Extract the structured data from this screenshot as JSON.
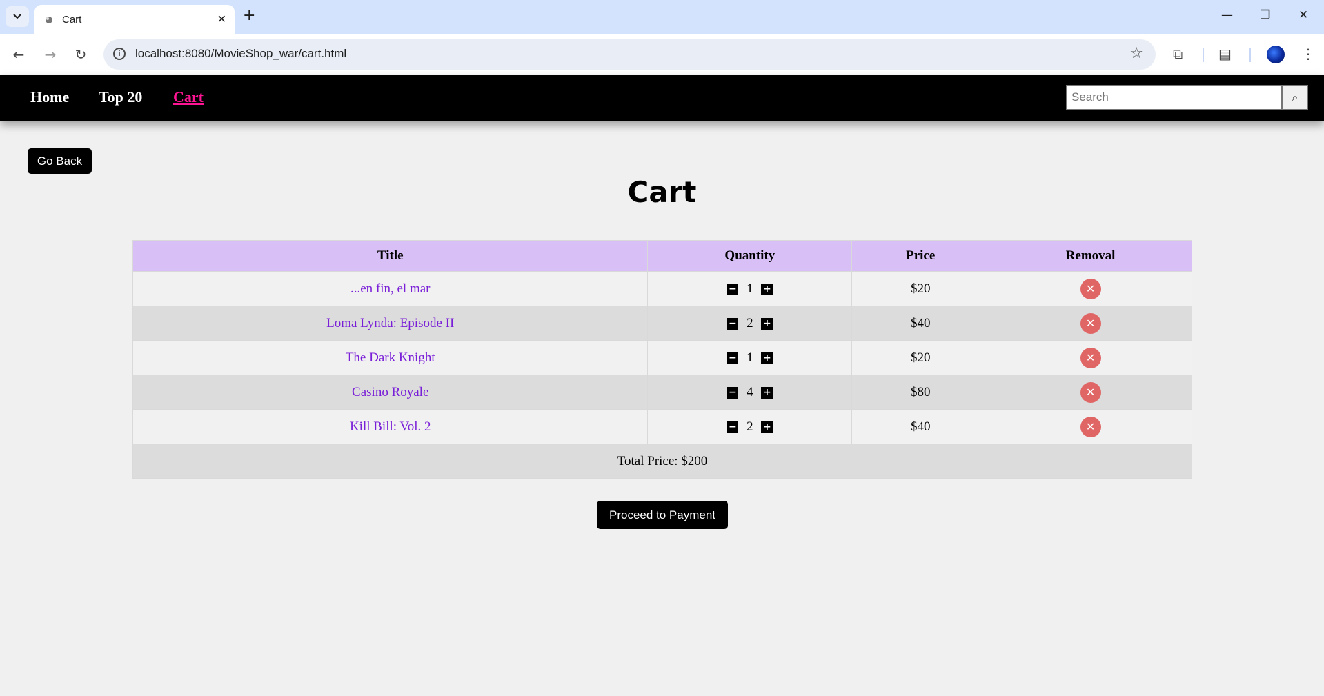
{
  "browser": {
    "tab_title": "Cart",
    "url": "localhost:8080/MovieShop_war/cart.html"
  },
  "nav": {
    "links": [
      {
        "label": "Home",
        "active": false
      },
      {
        "label": "Top 20",
        "active": false
      },
      {
        "label": "Cart",
        "active": true
      }
    ],
    "search_placeholder": "Search"
  },
  "page": {
    "go_back_label": "Go Back",
    "title": "Cart",
    "proceed_label": "Proceed to Payment"
  },
  "cart": {
    "headers": [
      "Title",
      "Quantity",
      "Price",
      "Removal"
    ],
    "items": [
      {
        "title": "...en fin, el mar",
        "quantity": "1",
        "price": "$20"
      },
      {
        "title": "Loma Lynda: Episode II",
        "quantity": "2",
        "price": "$40"
      },
      {
        "title": "The Dark Knight",
        "quantity": "1",
        "price": "$20"
      },
      {
        "title": "Casino Royale",
        "quantity": "4",
        "price": "$80"
      },
      {
        "title": "Kill Bill: Vol. 2",
        "quantity": "2",
        "price": "$40"
      }
    ],
    "total": "Total Price: $200"
  },
  "colors": {
    "accent_link": "#ff1493",
    "header_bg": "#d8bff5",
    "movie_link": "#7a1fd8",
    "remove": "#e06666"
  },
  "icons": {
    "minus": "minus-icon",
    "plus": "plus-icon",
    "remove": "close-icon"
  }
}
